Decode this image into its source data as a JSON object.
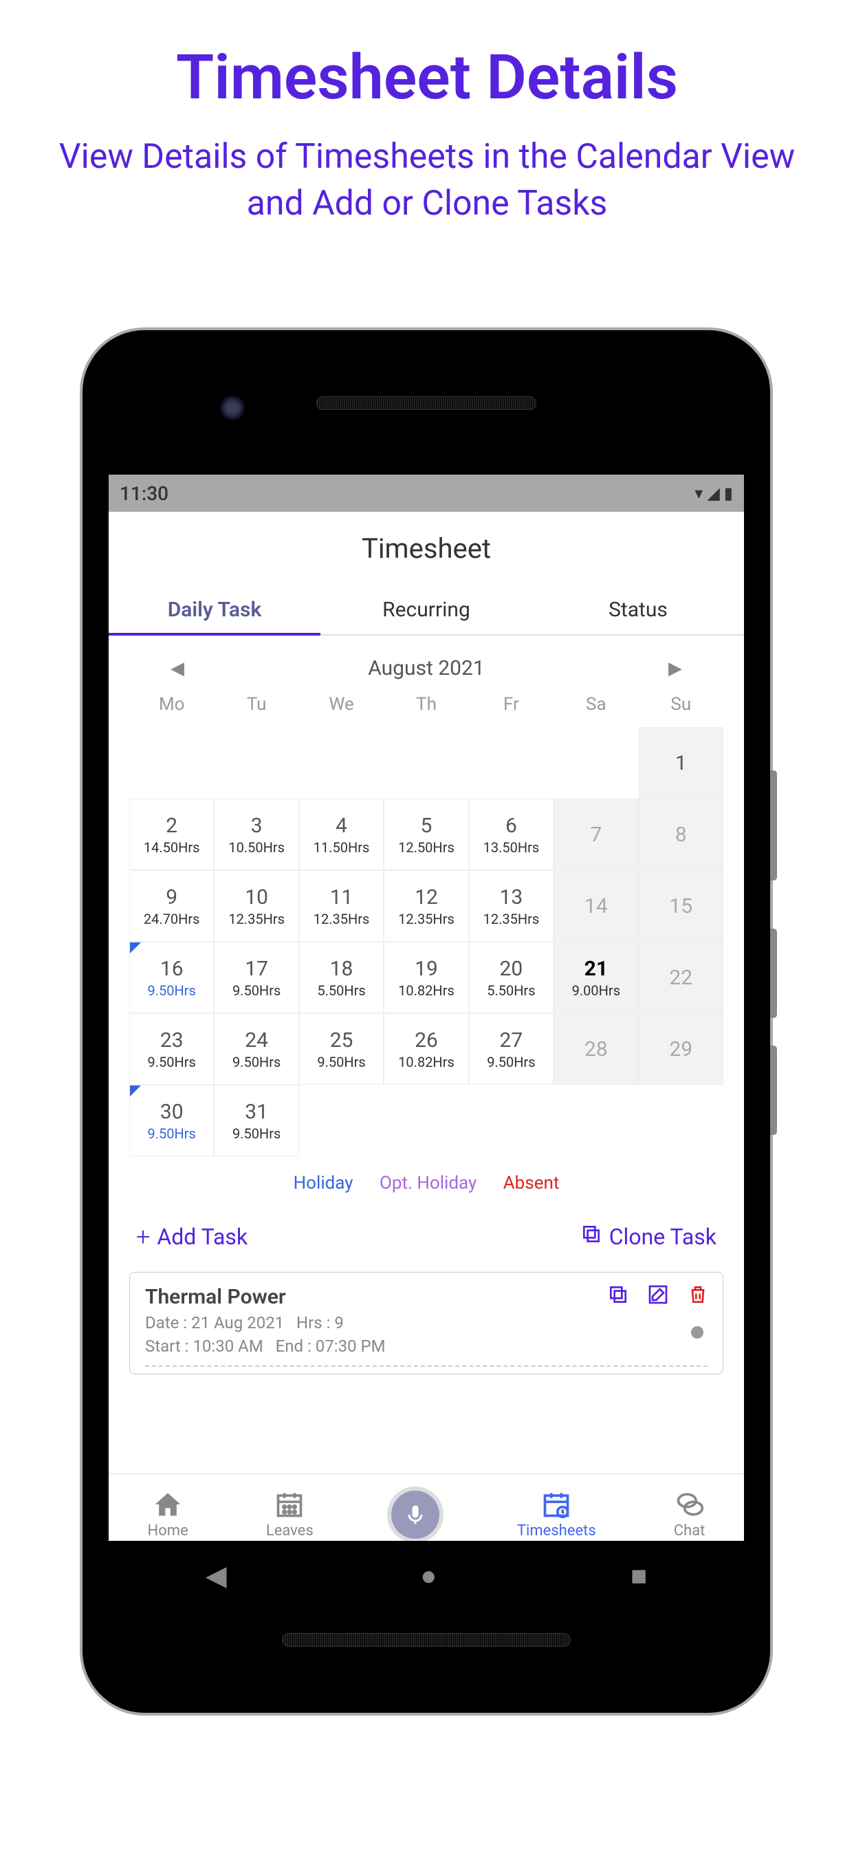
{
  "marketing": {
    "title": "Timesheet Details",
    "subtitle": "View Details of Timesheets in the Calendar View and Add or Clone Tasks"
  },
  "statusbar": {
    "time": "11:30"
  },
  "header": {
    "title": "Timesheet"
  },
  "tabs": {
    "daily": "Daily Task",
    "recurring": "Recurring",
    "status": "Status"
  },
  "calendar": {
    "month": "August 2021",
    "dow": [
      "Mo",
      "Tu",
      "We",
      "Th",
      "Fr",
      "Sa",
      "Su"
    ],
    "cells": [
      {
        "d": "",
        "t": "empty"
      },
      {
        "d": "",
        "t": "empty"
      },
      {
        "d": "",
        "t": "empty"
      },
      {
        "d": "",
        "t": "empty"
      },
      {
        "d": "",
        "t": "empty"
      },
      {
        "d": "",
        "t": "empty"
      },
      {
        "d": "1",
        "t": "weekend"
      },
      {
        "d": "2",
        "h": "14.50Hrs"
      },
      {
        "d": "3",
        "h": "10.50Hrs"
      },
      {
        "d": "4",
        "h": "11.50Hrs"
      },
      {
        "d": "5",
        "h": "12.50Hrs"
      },
      {
        "d": "6",
        "h": "13.50Hrs"
      },
      {
        "d": "7",
        "t": "weekend faded"
      },
      {
        "d": "8",
        "t": "weekend faded"
      },
      {
        "d": "9",
        "h": "24.70Hrs"
      },
      {
        "d": "10",
        "h": "12.35Hrs"
      },
      {
        "d": "11",
        "h": "12.35Hrs"
      },
      {
        "d": "12",
        "h": "12.35Hrs"
      },
      {
        "d": "13",
        "h": "12.35Hrs"
      },
      {
        "d": "14",
        "t": "weekend faded"
      },
      {
        "d": "15",
        "t": "weekend faded"
      },
      {
        "d": "16",
        "h": "9.50Hrs",
        "t": "mark",
        "hc": "blue"
      },
      {
        "d": "17",
        "h": "9.50Hrs"
      },
      {
        "d": "18",
        "h": "5.50Hrs"
      },
      {
        "d": "19",
        "h": "10.82Hrs"
      },
      {
        "d": "20",
        "h": "5.50Hrs"
      },
      {
        "d": "21",
        "h": "9.00Hrs",
        "t": "weekend today"
      },
      {
        "d": "22",
        "t": "weekend faded"
      },
      {
        "d": "23",
        "h": "9.50Hrs"
      },
      {
        "d": "24",
        "h": "9.50Hrs"
      },
      {
        "d": "25",
        "h": "9.50Hrs"
      },
      {
        "d": "26",
        "h": "10.82Hrs"
      },
      {
        "d": "27",
        "h": "9.50Hrs"
      },
      {
        "d": "28",
        "t": "weekend faded"
      },
      {
        "d": "29",
        "t": "weekend faded"
      },
      {
        "d": "30",
        "h": "9.50Hrs",
        "t": "mark",
        "hc": "blue"
      },
      {
        "d": "31",
        "h": "9.50Hrs"
      },
      {
        "d": "",
        "t": "empty"
      },
      {
        "d": "",
        "t": "empty"
      },
      {
        "d": "",
        "t": "empty"
      },
      {
        "d": "",
        "t": "empty"
      },
      {
        "d": "",
        "t": "empty"
      }
    ]
  },
  "legend": {
    "holiday": "Holiday",
    "opt": "Opt. Holiday",
    "absent": "Absent"
  },
  "actions": {
    "add": "Add Task",
    "clone": "Clone Task"
  },
  "task": {
    "title": "Thermal Power",
    "date_label": "Date : 21 Aug 2021",
    "hrs_label": "Hrs : 9",
    "start_label": "Start : 10:30 AM",
    "end_label": "End : 07:30 PM"
  },
  "nav": {
    "home": "Home",
    "leaves": "Leaves",
    "timesheets": "Timesheets",
    "chat": "Chat"
  }
}
